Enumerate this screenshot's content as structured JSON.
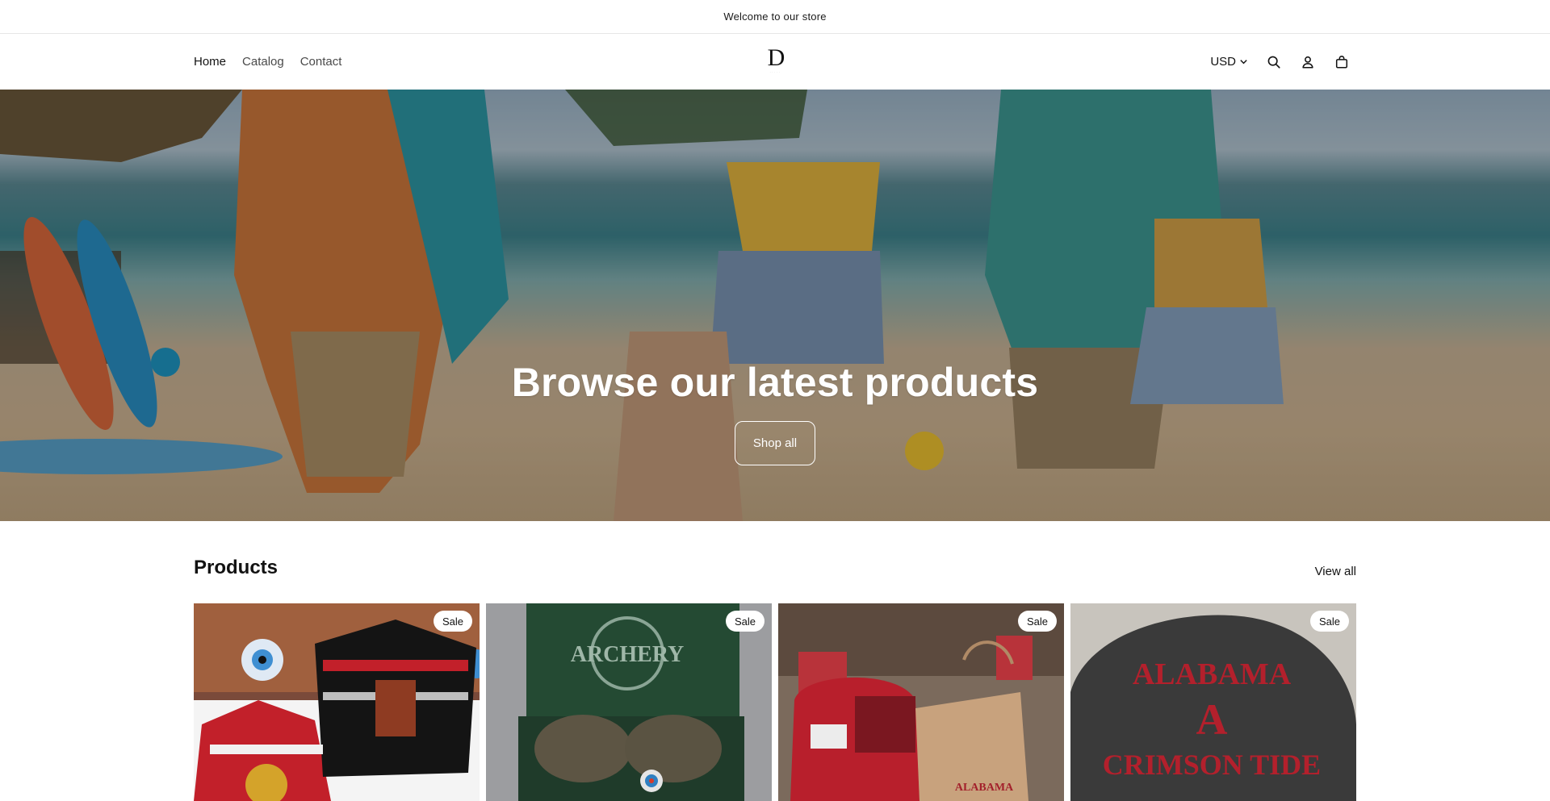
{
  "announcement": {
    "text": "Welcome to our store"
  },
  "header": {
    "nav": [
      {
        "label": "Home",
        "active": true
      },
      {
        "label": "Catalog",
        "active": false
      },
      {
        "label": "Contact",
        "active": false
      }
    ],
    "logo": {
      "mark": "D",
      "icon": "store-logo"
    },
    "currency": "USD",
    "icons": [
      "search-icon",
      "account-icon",
      "cart-icon"
    ]
  },
  "hero": {
    "title": "Browse our latest products",
    "button_label": "Shop all"
  },
  "products": {
    "title": "Products",
    "view_all_label": "View all",
    "items": [
      {
        "badge": "Sale",
        "image": "holiday-sweater"
      },
      {
        "badge": "Sale",
        "image": "archery-clogs"
      },
      {
        "badge": "Sale",
        "image": "alabama-gift-set"
      },
      {
        "badge": "Sale",
        "image": "alabama-crimson-tide-cap"
      }
    ]
  },
  "colors": {
    "text": "#121212",
    "border": "#e6e6e6",
    "hero_text": "#ffffff"
  }
}
